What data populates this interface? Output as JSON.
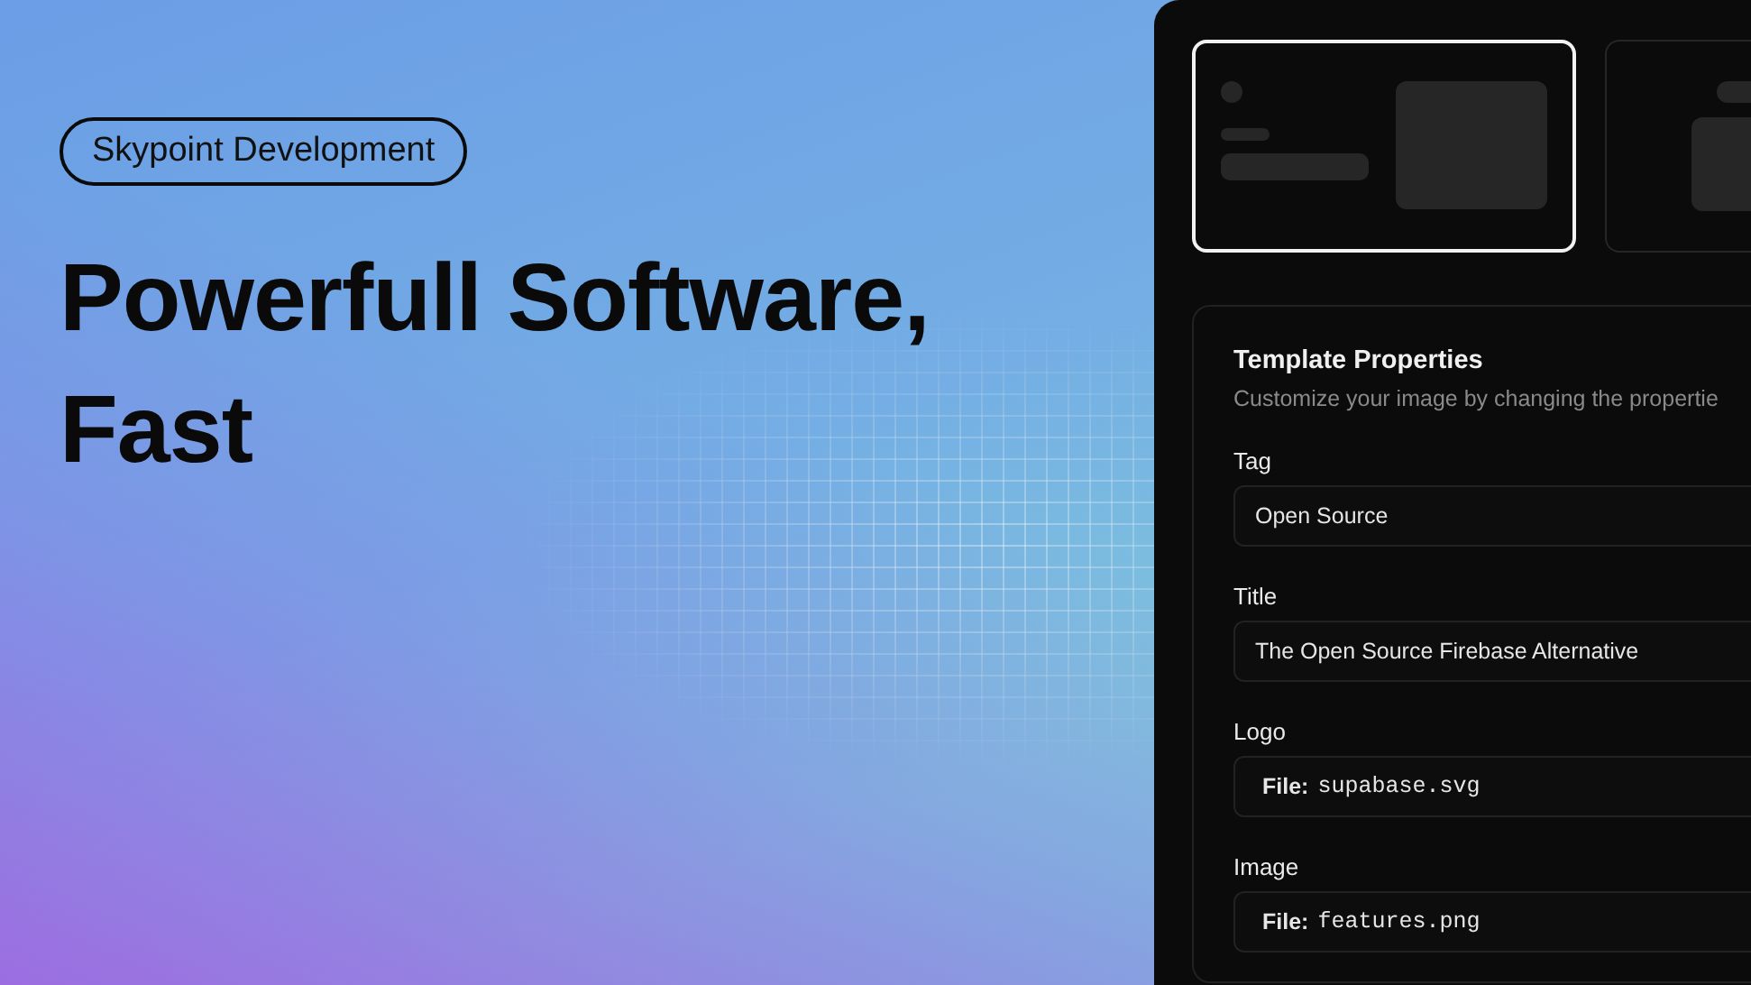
{
  "hero": {
    "tag": "Skypoint Development",
    "headline": [
      "Powerfull Software,",
      "Fast"
    ]
  },
  "templates": [
    {
      "kind": "split",
      "selected": true
    },
    {
      "kind": "stacked",
      "selected": false
    }
  ],
  "properties": {
    "title": "Template Properties",
    "subtitle": "Customize your image by changing the propertie",
    "fields": [
      {
        "label": "Tag",
        "kind": "text",
        "value": "Open Source"
      },
      {
        "label": "Title",
        "kind": "text",
        "value": "The Open Source Firebase Alternative"
      },
      {
        "label": "Logo",
        "kind": "file",
        "prefix": "File:",
        "value": "supabase.svg"
      },
      {
        "label": "Image",
        "kind": "file",
        "prefix": "File:",
        "value": "features.png"
      }
    ]
  }
}
